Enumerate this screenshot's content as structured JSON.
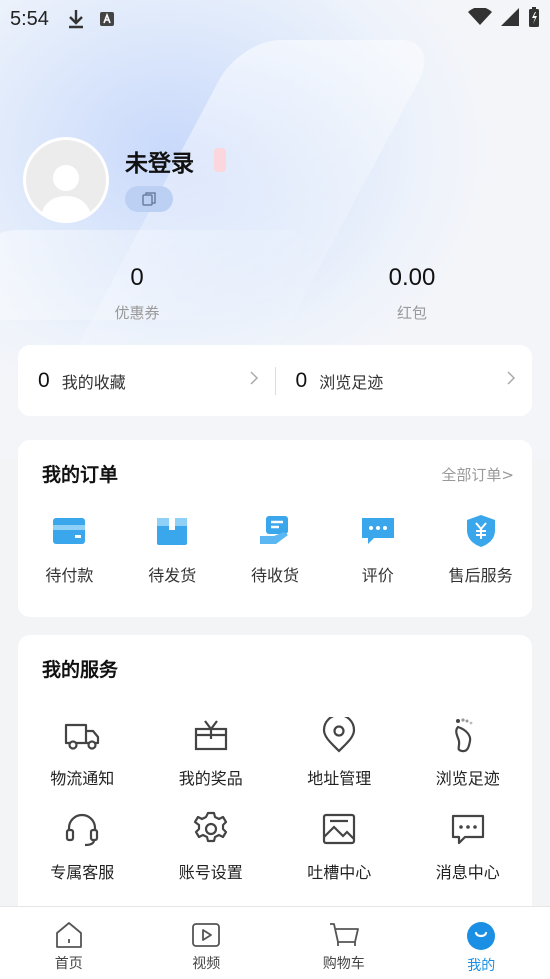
{
  "status_bar": {
    "time": "5:54"
  },
  "profile": {
    "username": "未登录"
  },
  "stats": [
    {
      "value": "0",
      "label": "优惠券"
    },
    {
      "value": "0.00",
      "label": "红包"
    }
  ],
  "favorites": [
    {
      "count": "0",
      "label": "我的收藏"
    },
    {
      "count": "0",
      "label": "浏览足迹"
    }
  ],
  "orders": {
    "title": "我的订单",
    "all_link": "全部订单>",
    "items": [
      {
        "label": "待付款",
        "icon": "wallet-icon"
      },
      {
        "label": "待发货",
        "icon": "package-icon"
      },
      {
        "label": "待收货",
        "icon": "receive-icon"
      },
      {
        "label": "评价",
        "icon": "comment-icon"
      },
      {
        "label": "售后服务",
        "icon": "after-sales-icon"
      }
    ]
  },
  "services": {
    "title": "我的服务",
    "items": [
      {
        "label": "物流通知",
        "icon": "truck-icon"
      },
      {
        "label": "我的奖品",
        "icon": "gift-icon"
      },
      {
        "label": "地址管理",
        "icon": "location-icon"
      },
      {
        "label": "浏览足迹",
        "icon": "footprint-icon"
      },
      {
        "label": "专属客服",
        "icon": "headset-icon"
      },
      {
        "label": "账号设置",
        "icon": "gear-icon"
      },
      {
        "label": "吐槽中心",
        "icon": "image-icon"
      },
      {
        "label": "消息中心",
        "icon": "message-icon"
      }
    ]
  },
  "bottom_nav": [
    {
      "label": "首页",
      "icon": "home-icon"
    },
    {
      "label": "视频",
      "icon": "video-icon"
    },
    {
      "label": "购物车",
      "icon": "cart-icon"
    },
    {
      "label": "我的",
      "icon": "profile-icon",
      "active": true
    }
  ],
  "colors": {
    "accent": "#1a8fe3",
    "order_icon_blue": "#3aa6ec"
  }
}
